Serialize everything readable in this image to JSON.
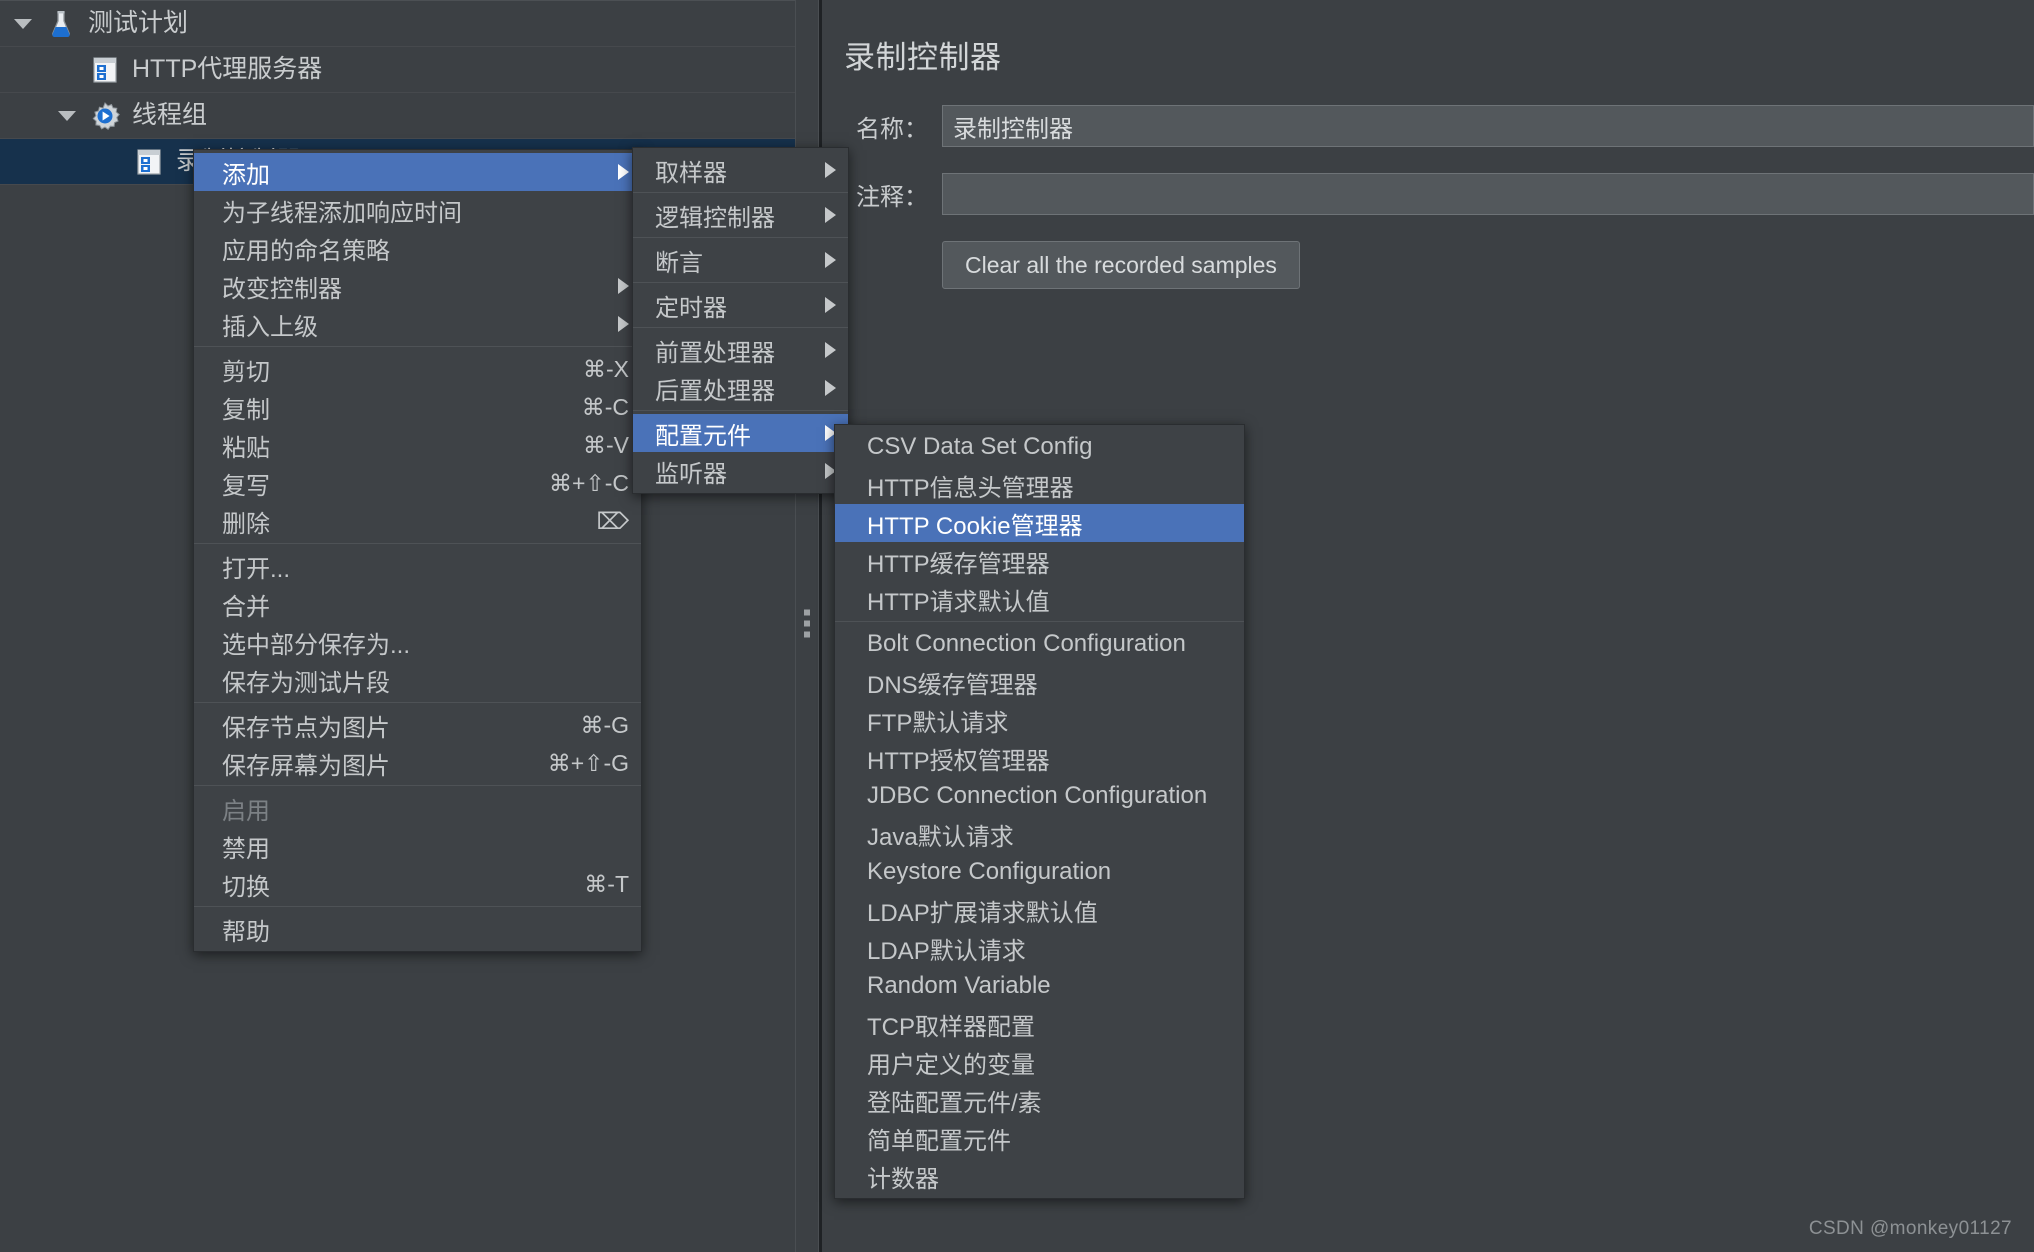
{
  "tree": {
    "nodes": [
      {
        "label": "测试计划",
        "icon": "flask-icon",
        "indent": 0,
        "expanded": true,
        "selected": false
      },
      {
        "label": "HTTP代理服务器",
        "icon": "http-proxy-icon",
        "indent": 1,
        "expanded": null,
        "selected": false
      },
      {
        "label": "线程组",
        "icon": "thread-group-icon",
        "indent": 1,
        "expanded": true,
        "selected": false
      },
      {
        "label": "录制控制器",
        "icon": "recording-controller-icon",
        "indent": 2,
        "expanded": null,
        "selected": true
      }
    ]
  },
  "editor": {
    "title": "录制控制器",
    "name_label": "名称：",
    "name_value": "录制控制器",
    "comment_label": "注释：",
    "comment_value": "",
    "clear_button": "Clear all the recorded samples"
  },
  "context_menu": {
    "sections": [
      {
        "items": [
          {
            "label": "添加",
            "accel": "",
            "submenu": true,
            "highlight": true,
            "disabled": false
          },
          {
            "label": "为子线程添加响应时间",
            "accel": "",
            "submenu": false,
            "highlight": false,
            "disabled": false
          },
          {
            "label": "应用的命名策略",
            "accel": "",
            "submenu": false,
            "highlight": false,
            "disabled": false
          },
          {
            "label": "改变控制器",
            "accel": "",
            "submenu": true,
            "highlight": false,
            "disabled": false
          },
          {
            "label": "插入上级",
            "accel": "",
            "submenu": true,
            "highlight": false,
            "disabled": false
          }
        ]
      },
      {
        "items": [
          {
            "label": "剪切",
            "accel": "⌘-X",
            "submenu": false,
            "highlight": false,
            "disabled": false
          },
          {
            "label": "复制",
            "accel": "⌘-C",
            "submenu": false,
            "highlight": false,
            "disabled": false
          },
          {
            "label": "粘贴",
            "accel": "⌘-V",
            "submenu": false,
            "highlight": false,
            "disabled": false
          },
          {
            "label": "复写",
            "accel": "⌘+⇧-C",
            "submenu": false,
            "highlight": false,
            "disabled": false
          },
          {
            "label": "删除",
            "accel": "⌦",
            "submenu": false,
            "highlight": false,
            "disabled": false
          }
        ]
      },
      {
        "items": [
          {
            "label": "打开...",
            "accel": "",
            "submenu": false,
            "highlight": false,
            "disabled": false
          },
          {
            "label": "合并",
            "accel": "",
            "submenu": false,
            "highlight": false,
            "disabled": false
          },
          {
            "label": "选中部分保存为...",
            "accel": "",
            "submenu": false,
            "highlight": false,
            "disabled": false
          },
          {
            "label": "保存为测试片段",
            "accel": "",
            "submenu": false,
            "highlight": false,
            "disabled": false
          }
        ]
      },
      {
        "items": [
          {
            "label": "保存节点为图片",
            "accel": "⌘-G",
            "submenu": false,
            "highlight": false,
            "disabled": false
          },
          {
            "label": "保存屏幕为图片",
            "accel": "⌘+⇧-G",
            "submenu": false,
            "highlight": false,
            "disabled": false
          }
        ]
      },
      {
        "items": [
          {
            "label": "启用",
            "accel": "",
            "submenu": false,
            "highlight": false,
            "disabled": true
          },
          {
            "label": "禁用",
            "accel": "",
            "submenu": false,
            "highlight": false,
            "disabled": false
          },
          {
            "label": "切换",
            "accel": "⌘-T",
            "submenu": false,
            "highlight": false,
            "disabled": false
          }
        ]
      },
      {
        "items": [
          {
            "label": "帮助",
            "accel": "",
            "submenu": false,
            "highlight": false,
            "disabled": false
          }
        ]
      }
    ]
  },
  "add_menu": {
    "sections": [
      {
        "items": [
          {
            "label": "取样器",
            "submenu": true,
            "highlight": false
          }
        ]
      },
      {
        "items": [
          {
            "label": "逻辑控制器",
            "submenu": true,
            "highlight": false
          }
        ]
      },
      {
        "items": [
          {
            "label": "断言",
            "submenu": true,
            "highlight": false
          }
        ]
      },
      {
        "items": [
          {
            "label": "定时器",
            "submenu": true,
            "highlight": false
          }
        ]
      },
      {
        "items": [
          {
            "label": "前置处理器",
            "submenu": true,
            "highlight": false
          },
          {
            "label": "后置处理器",
            "submenu": true,
            "highlight": false
          }
        ]
      },
      {
        "items": [
          {
            "label": "配置元件",
            "submenu": true,
            "highlight": true
          },
          {
            "label": "监听器",
            "submenu": true,
            "highlight": false
          }
        ]
      }
    ]
  },
  "config_menu": {
    "sections": [
      {
        "items": [
          {
            "label": "CSV Data Set Config",
            "highlight": false
          },
          {
            "label": "HTTP信息头管理器",
            "highlight": false
          },
          {
            "label": "HTTP Cookie管理器",
            "highlight": true
          },
          {
            "label": "HTTP缓存管理器",
            "highlight": false
          },
          {
            "label": "HTTP请求默认值",
            "highlight": false
          }
        ]
      },
      {
        "items": [
          {
            "label": "Bolt Connection Configuration",
            "highlight": false
          },
          {
            "label": "DNS缓存管理器",
            "highlight": false
          },
          {
            "label": "FTP默认请求",
            "highlight": false
          },
          {
            "label": "HTTP授权管理器",
            "highlight": false
          },
          {
            "label": "JDBC Connection Configuration",
            "highlight": false
          },
          {
            "label": "Java默认请求",
            "highlight": false
          },
          {
            "label": "Keystore Configuration",
            "highlight": false
          },
          {
            "label": "LDAP扩展请求默认值",
            "highlight": false
          },
          {
            "label": "LDAP默认请求",
            "highlight": false
          },
          {
            "label": "Random Variable",
            "highlight": false
          },
          {
            "label": "TCP取样器配置",
            "highlight": false
          },
          {
            "label": "用户定义的变量",
            "highlight": false
          },
          {
            "label": "登陆配置元件/素",
            "highlight": false
          },
          {
            "label": "简单配置元件",
            "highlight": false
          },
          {
            "label": "计数器",
            "highlight": false
          }
        ]
      }
    ]
  },
  "watermark": "CSDN @monkey01127",
  "colors": {
    "background": "#3c4044",
    "menu_background": "#3e4246",
    "highlight": "#4a72b8",
    "tree_selected": "#16314c",
    "text": "#c9ccce",
    "input_background": "#53585c"
  }
}
